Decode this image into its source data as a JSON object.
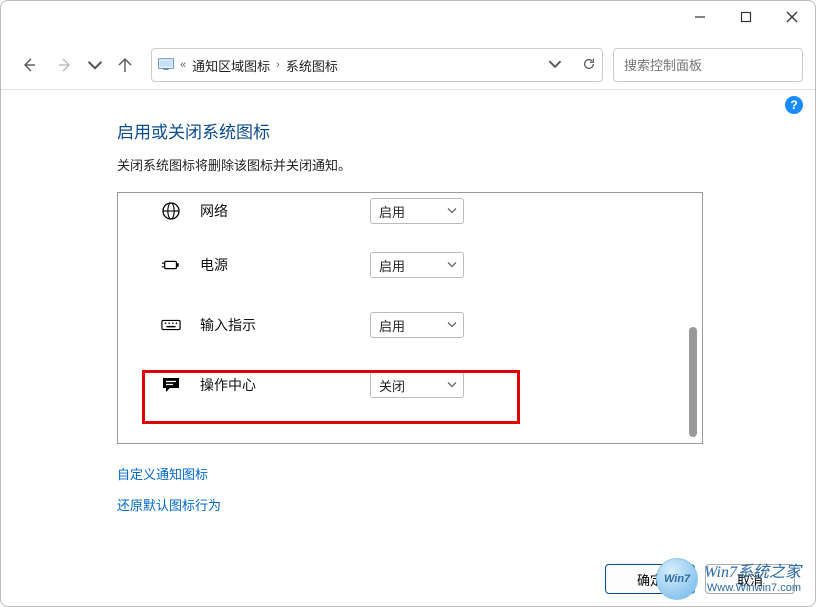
{
  "window": {
    "minimize_tip": "Minimize",
    "maximize_tip": "Maximize",
    "close_tip": "Close"
  },
  "breadcrumb": {
    "parent": "通知区域图标",
    "current": "系统图标"
  },
  "search": {
    "placeholder": "搜索控制面板"
  },
  "page": {
    "title": "启用或关闭系统图标",
    "subtitle": "关闭系统图标将删除该图标并关闭通知。"
  },
  "options": {
    "enabled": "启用",
    "disabled": "关闭"
  },
  "rows": [
    {
      "icon": "network",
      "label": "网络",
      "value": "启用"
    },
    {
      "icon": "power",
      "label": "电源",
      "value": "启用"
    },
    {
      "icon": "ime",
      "label": "输入指示",
      "value": "启用"
    },
    {
      "icon": "action-center",
      "label": "操作中心",
      "value": "关闭"
    }
  ],
  "links": {
    "customize": "自定义通知图标",
    "restore": "还原默认图标行为"
  },
  "buttons": {
    "ok": "确定",
    "cancel": "取消"
  },
  "watermark": {
    "badge": "Win7",
    "line1": "Win7系统之家",
    "line2": "Www.Winwin7.com"
  }
}
